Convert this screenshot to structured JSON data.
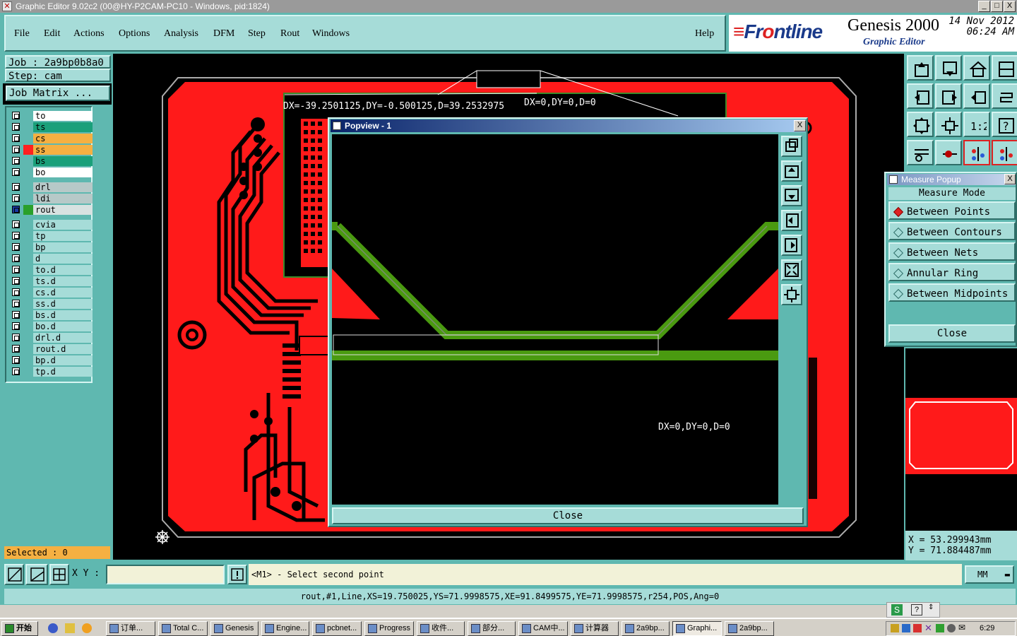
{
  "window": {
    "title": "Graphic Editor 9.02c2 (00@HY-P2CAM-PC10 - Windows, pid:1824)",
    "minimize": "_",
    "maximize": "□",
    "close": "X"
  },
  "menu": {
    "file": "File",
    "edit": "Edit",
    "actions": "Actions",
    "options": "Options",
    "analysis": "Analysis",
    "dfm": "DFM",
    "step": "Step",
    "rout": "Rout",
    "windows": "Windows",
    "help": "Help"
  },
  "brand": {
    "logo_front": "Fr",
    "logo_o": "o",
    "logo_back": "ntline",
    "product": "Genesis 2000",
    "subtitle": "Graphic Editor",
    "date": "14 Nov 2012",
    "time": "06:24 AM"
  },
  "job": {
    "job_label": "Job : 2a9bp0b8a0",
    "step_label": "Step: cam",
    "matrix_button": "Job Matrix ..."
  },
  "layers": [
    {
      "name": "to",
      "color": "#ffffff",
      "marker": ""
    },
    {
      "name": "ts",
      "color": "#1aa07a",
      "marker": ""
    },
    {
      "name": "cs",
      "color": "#f5b042",
      "marker": ""
    },
    {
      "name": "ss",
      "color": "#f5b042",
      "marker": "#ff2020"
    },
    {
      "name": "bs",
      "color": "#1aa07a",
      "marker": ""
    },
    {
      "name": "bo",
      "color": "#ffffff",
      "marker": ""
    },
    {
      "name": "drl",
      "color": "#b7c9c8",
      "marker": ""
    },
    {
      "name": "ldi",
      "color": "#b7c9c8",
      "marker": ""
    },
    {
      "name": "rout",
      "color": "#d8e2e1",
      "marker": "#2aa02a"
    },
    {
      "name": "cvia",
      "color": "#a6dcd8",
      "marker": ""
    },
    {
      "name": "tp",
      "color": "#a6dcd8",
      "marker": ""
    },
    {
      "name": "bp",
      "color": "#a6dcd8",
      "marker": ""
    },
    {
      "name": "d",
      "color": "#a6dcd8",
      "marker": ""
    },
    {
      "name": "to.d",
      "color": "#a6dcd8",
      "marker": ""
    },
    {
      "name": "ts.d",
      "color": "#a6dcd8",
      "marker": ""
    },
    {
      "name": "cs.d",
      "color": "#a6dcd8",
      "marker": ""
    },
    {
      "name": "ss.d",
      "color": "#a6dcd8",
      "marker": ""
    },
    {
      "name": "bs.d",
      "color": "#a6dcd8",
      "marker": ""
    },
    {
      "name": "bo.d",
      "color": "#a6dcd8",
      "marker": ""
    },
    {
      "name": "drl.d",
      "color": "#a6dcd8",
      "marker": ""
    },
    {
      "name": "rout.d",
      "color": "#a6dcd8",
      "marker": ""
    },
    {
      "name": "bp.d",
      "color": "#a6dcd8",
      "marker": ""
    },
    {
      "name": "tp.d",
      "color": "#a6dcd8",
      "marker": ""
    }
  ],
  "selected": "Selected : 0",
  "canvas": {
    "measure_readout": "DX=-39.2501125,DY=-0.500125,D=39.2532975",
    "measure_readout2": "DX=0,DY=0,D=0"
  },
  "popview": {
    "title": "Popview - 1",
    "close_x": "X",
    "readout": "DX=0,DY=0,D=0",
    "close_button": "Close"
  },
  "measure": {
    "title": "Measure Popup",
    "close_x": "X",
    "mode_label": "Measure Mode",
    "options": [
      "Between Points",
      "Between Contours",
      "Between Nets",
      "Annular Ring",
      "Between Midpoints"
    ],
    "selected_index": 0,
    "close_button": "Close"
  },
  "coords": {
    "x": "X = 53.299943mm",
    "y": "Y = 71.884487mm"
  },
  "bottom": {
    "xy_label": "X Y :",
    "xy_value": "",
    "prompt": "<M1> - Select second point",
    "units": "MM"
  },
  "info": "rout,#1,Line,XS=19.750025,YS=71.9998575,XE=91.8499575,YE=71.9998575,r254,POS,Ang=0",
  "taskbar": {
    "start": "开始",
    "tasks": [
      "订单...",
      "Total C...",
      "Genesis",
      "Engine...",
      "pcbnet...",
      "Progress",
      "收件...",
      "部分...",
      "CAM中...",
      "计算器",
      "2a9bp...",
      "Graphi...",
      "2a9bp..."
    ],
    "clock": "6:29"
  },
  "colors": {
    "panel": "#5fb8b0",
    "field": "#a6dcd8",
    "copper": "#ff1a1a",
    "rout": "#4a9a10"
  }
}
